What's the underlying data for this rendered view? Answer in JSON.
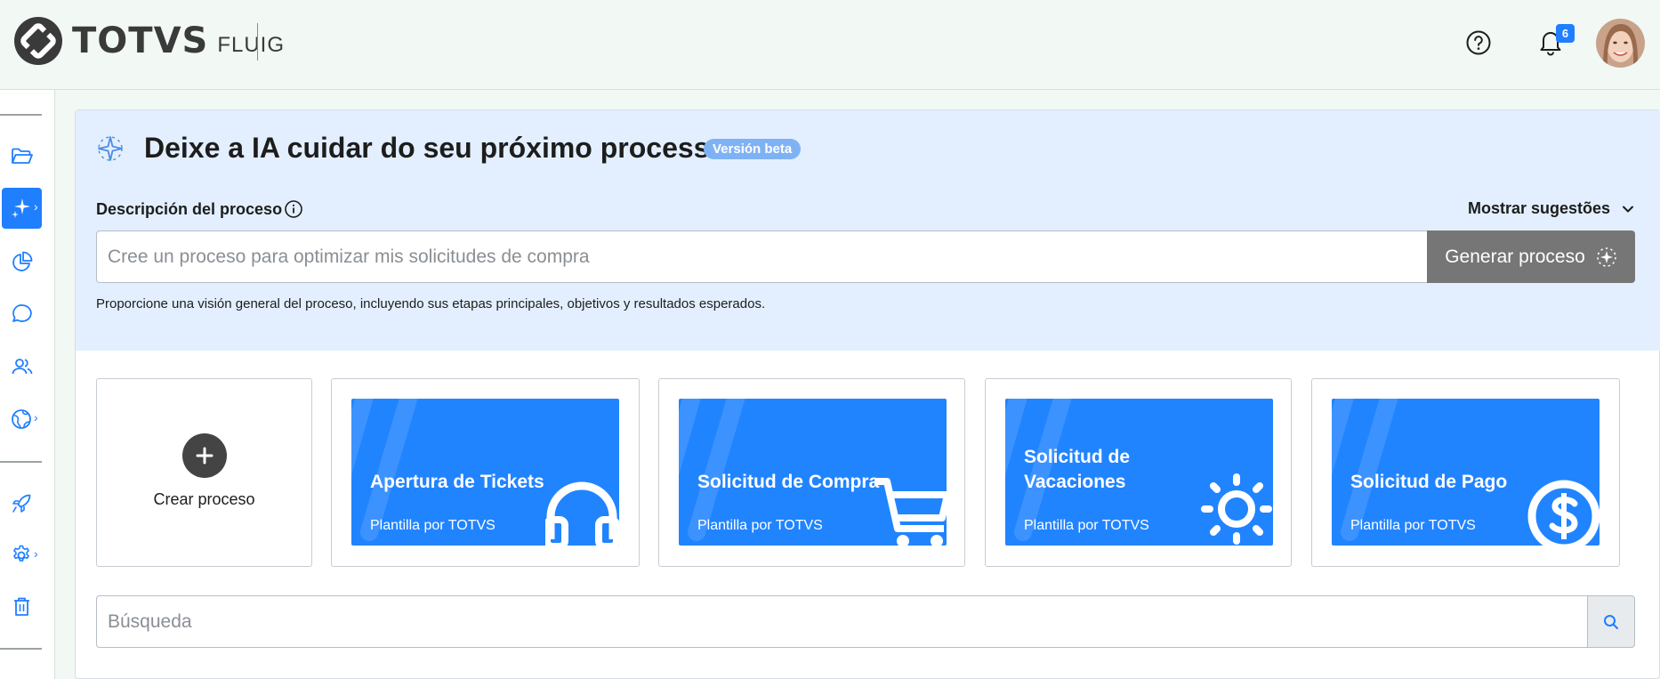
{
  "header": {
    "brand": "TOTVS",
    "product": "FLUIG",
    "notifications_count": "6",
    "icons": {
      "help": "help-circle-icon",
      "bell": "bell-icon"
    }
  },
  "sidebar": {
    "items": [
      {
        "name": "folder",
        "icon": "folder-open-icon"
      },
      {
        "name": "processes",
        "icon": "sparkle-process-icon",
        "active": true
      },
      {
        "name": "analytics",
        "icon": "pie-chart-icon"
      },
      {
        "name": "chat",
        "icon": "chat-bubble-icon"
      },
      {
        "name": "users",
        "icon": "users-icon"
      },
      {
        "name": "global",
        "icon": "globe-icon"
      },
      {
        "name": "launch",
        "icon": "rocket-icon"
      },
      {
        "name": "settings",
        "icon": "gear-icon"
      },
      {
        "name": "trash",
        "icon": "trash-icon"
      }
    ],
    "accent": "#1f7fff"
  },
  "ai": {
    "title": "Deixe a IA cuidar do seu próximo processo",
    "badge": "Versión beta",
    "description_label": "Descripción del proceso",
    "suggestions_toggle": "Mostrar sugestões",
    "input_value": "",
    "input_placeholder": "Cree un proceso para optimizar mis solicitudes de compra",
    "generate_button": "Generar proceso",
    "helper_text": "Proporcione una visión general del proceso, incluyendo sus etapas principales, objetivos y resultados esperados."
  },
  "create": {
    "label": "Crear proceso"
  },
  "templates": [
    {
      "title_line1": "Apertura de Tickets",
      "title_line2": "",
      "subtitle": "Plantilla por TOTVS",
      "icon": "headphones-icon"
    },
    {
      "title_line1": "Solicitud de Compra",
      "title_line2": "",
      "subtitle": "Plantilla por TOTVS",
      "icon": "shopping-cart-icon"
    },
    {
      "title_line1": "Solicitud de",
      "title_line2": "Vacaciones",
      "subtitle": "Plantilla por TOTVS",
      "icon": "sun-icon"
    },
    {
      "title_line1": "Solicitud de Pago",
      "title_line2": "",
      "subtitle": "Plantilla por TOTVS",
      "icon": "dollar-coin-icon"
    }
  ],
  "search": {
    "value": "",
    "placeholder": "Búsqueda"
  },
  "colors": {
    "primary": "#2184ff",
    "panel": "#e3efff",
    "button_disabled": "#767676"
  }
}
